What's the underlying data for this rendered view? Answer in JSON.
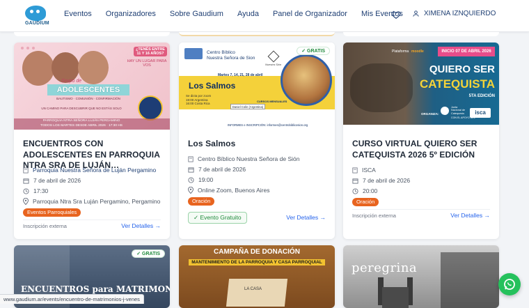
{
  "brand": {
    "logo_text": "GAUDIUM"
  },
  "nav": {
    "items": [
      {
        "label": "Eventos"
      },
      {
        "label": "Organizadores"
      },
      {
        "label": "Sobre Gaudium"
      },
      {
        "label": "Ayuda"
      },
      {
        "label": "Panel de Organizador"
      },
      {
        "label": "Mis Eventos"
      }
    ],
    "user_name": "XIMENA IZNQUIERDO"
  },
  "cards": [
    {
      "title": "ENCUENTROS CON ADOLESCENTES EN PARROQUIA NTRA SRA DE LUJÁN…",
      "organizer": "Parroquia Nuestra Señora de Luján Pergamino",
      "date": "7 de abril de 2026",
      "time": "17:30",
      "location": "Parroquia Ntra Sra Luján Pergamino, Pergamino",
      "tag": "Eventos Parroquiales",
      "footer": "Inscripción externa",
      "more": "Ver Detalles →",
      "image": {
        "top": "¿TENÉS ENTRE 11 Y 16 AÑOS?",
        "sub": "HAY UN LUGAR PARA VOS",
        "kicker": "Grupo de",
        "headline": "ADOLESCENTES",
        "line1": "BAUTISMO · COMUNIÓN · CONFIRMACIÓN",
        "line2": "UN CAMINO PARA DESCUBRIR QUE NO ESTÁS SOLO",
        "line3": "PARROQUIA NTRA SEÑORA LUJÁN PERGAMINO",
        "line4": "TODOS LOS MARTES DESDE ABRIL 2026 · 17:30 HS"
      }
    },
    {
      "title": "Los Salmos",
      "gratis": "✓ GRATIS",
      "organizer": "Centro Bíblico Nuestra Señora de Sión",
      "date": "7 de abril de 2026",
      "time": "19:00",
      "location": "Online Zoom, Buenos Aires",
      "tag": "Oración",
      "free_label": "✓ Evento Gratuito",
      "more": "Ver Detalles →",
      "image": {
        "org1": "Centro Bíblico",
        "org2": "Nuestra Señora de Sion",
        "sion": "Nuestra Sión",
        "dates": "Martes 7, 14, 21, 28 de abril",
        "headline": "Los Salmos",
        "teacher": "Daniel Colin (Argentina)",
        "courses": "CURSOS MENSUALES",
        "zoom": "Se dicta por zoom",
        "tz1": "19:00 Argentina",
        "tz2": "16:00 Costa Rica",
        "info": "INFORMES e INSCRIPCIÓN: informes@centrobiblicosion.org"
      }
    },
    {
      "title": "CURSO VIRTUAL QUIERO SER CATEQUISTA 2026 5º EDICIÓN",
      "organizer": "ISCA",
      "date": "7 de abril de 2026",
      "time": "20:00",
      "tag": "Oración",
      "footer": "Inscripción externa",
      "more": "Ver Detalles →",
      "image": {
        "platform": "Plataforma",
        "moodle": "moodle",
        "banner": "INICIO 07 DE ABRIL 2026",
        "head1": "QUIERO SER",
        "head2": "CATEQUISTA",
        "edition": "5TA EDICIÓN",
        "organiza": "ORGANIZA:",
        "junta1": "Junta",
        "junta2": "Nacional de",
        "junta3": "Catequesis",
        "apoyo": "CON EL APOYO DEL",
        "isca": "isca"
      }
    },
    {
      "gratis": "✓ GRATIS",
      "image": {
        "headline": "ENCUENTROS para MATRIMONIOS"
      }
    },
    {
      "image": {
        "line1": "CAMPAÑA DE DONACIÓN",
        "line2": "MANTENIMIENTO DE LA PARROQUIA Y CASA PARROQUIAL",
        "caption": "LA CASA"
      }
    },
    {
      "image": {
        "headline": "peregrina"
      }
    }
  ],
  "status_url": "www.gaudium.ar/events/encuentro-de-matrimonios-j-venes",
  "colors": {
    "accent": "#2563eb",
    "tag": "#e8641f",
    "free": "#1f8a3b",
    "whatsapp": "#25c15c"
  }
}
